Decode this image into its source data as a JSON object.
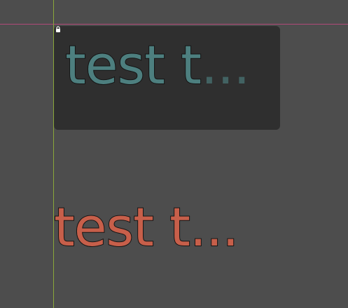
{
  "canvas": {
    "background": "#4d4d4d"
  },
  "guides": {
    "horizontal_color": "#b04a78",
    "vertical_color": "#8aa73a"
  },
  "label_1": {
    "text": "test t",
    "ellipsis": "...",
    "text_color": "#4d7f7f",
    "panel_color": "#2f2f2f",
    "locked_icon": "lock-icon"
  },
  "label_2": {
    "text": "test t...",
    "text_color": "#c75f4a"
  }
}
